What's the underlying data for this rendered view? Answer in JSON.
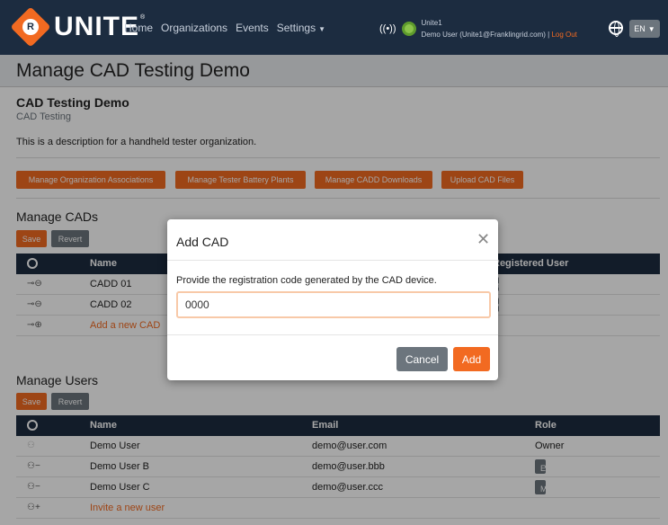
{
  "navbar": {
    "brand": "UNITE",
    "brand_mark": "®",
    "links": [
      "Home",
      "Organizations",
      "Events",
      "Settings"
    ],
    "user_name": "Unite1",
    "user_detail": "Demo User (Unite1@Franklingrid.com) |",
    "logout": "Log Out",
    "language": "EN"
  },
  "page": {
    "title": "Manage CAD Testing Demo",
    "org_name": "CAD Testing Demo",
    "org_sub": "CAD Testing",
    "org_desc": "This is a description for a handheld tester organization."
  },
  "org_buttons": [
    "Manage Organization Associations",
    "Manage Tester Battery Plants",
    "Manage CADD Downloads",
    "Upload CAD Files"
  ],
  "cads": {
    "title": "Manage CADs",
    "save": "Save",
    "revert": "Revert",
    "col_name": "Name",
    "col_user": "Registered User",
    "rows": [
      {
        "name": "CADD 01",
        "user": "demo@user.com"
      },
      {
        "name": "CADD 02",
        "user": ""
      }
    ],
    "add": "Add a new CAD"
  },
  "users": {
    "title": "Manage Users",
    "save": "Save",
    "revert": "Revert",
    "col_name": "Name",
    "col_email": "Email",
    "col_role": "Role",
    "rows": [
      {
        "name": "Demo User",
        "email": "demo@user.com",
        "role": "Owner"
      },
      {
        "name": "Demo User B",
        "email": "demo@user.bbb",
        "role": "Editor"
      },
      {
        "name": "Demo User C",
        "email": "demo@user.ccc",
        "role": "Member"
      }
    ],
    "invite": "Invite a new user"
  },
  "modal": {
    "title": "Add CAD",
    "text": "Provide the registration code generated by the CAD device.",
    "input_value": "0000",
    "cancel": "Cancel",
    "add": "Add"
  },
  "colors": {
    "navy": "#1c2c40",
    "orange": "#f26a21",
    "grey": "#6c757d"
  }
}
